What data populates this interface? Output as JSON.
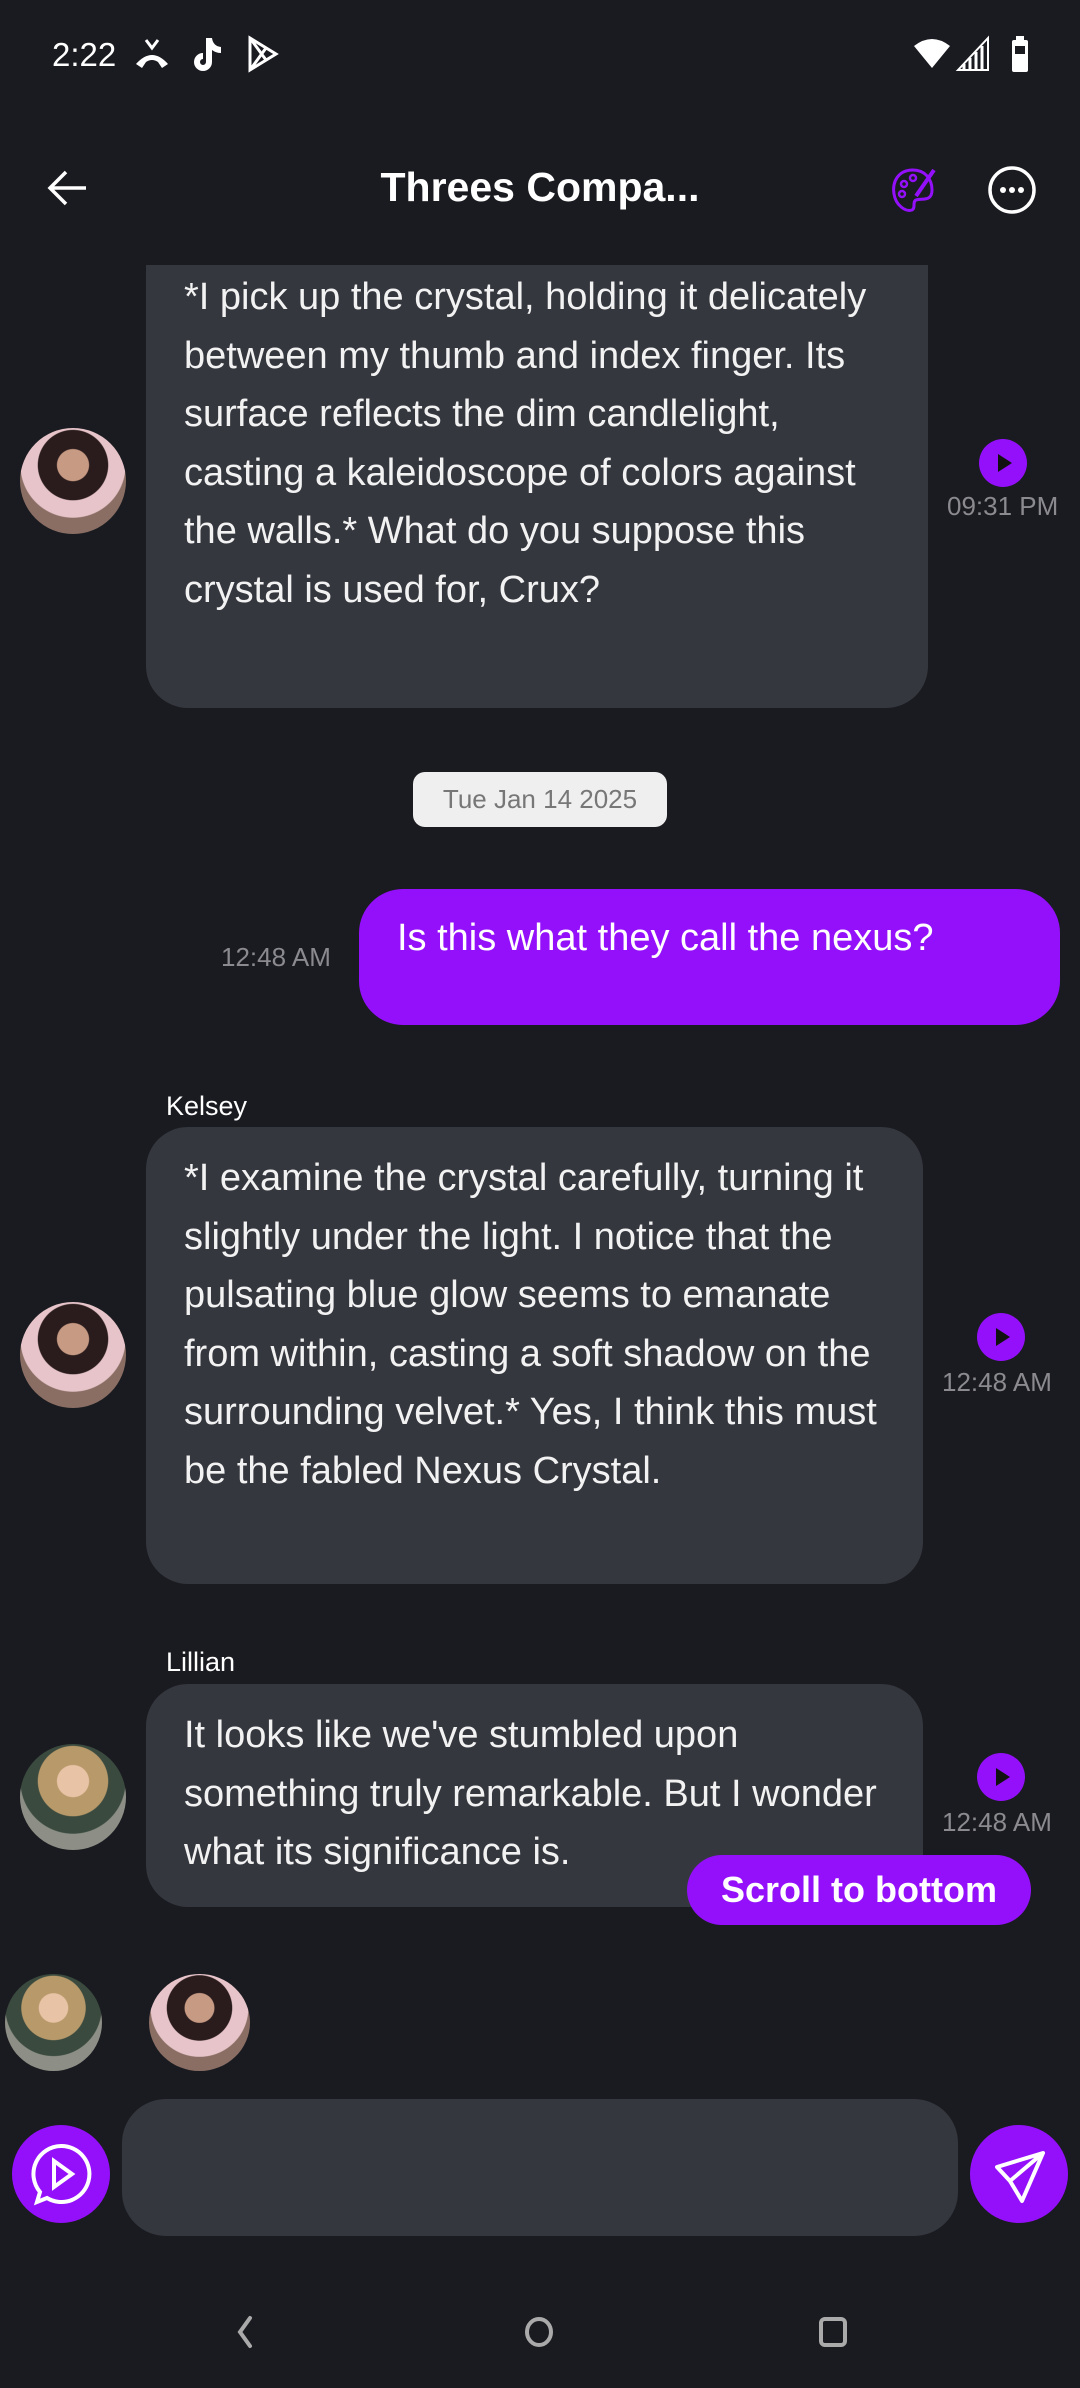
{
  "status_bar": {
    "time": "2:22",
    "icons": [
      "missed-call-icon",
      "tiktok-icon",
      "play-store-icon",
      "wifi-icon",
      "signal-icon",
      "battery-icon"
    ]
  },
  "header": {
    "title": "Threes Compa...",
    "icons": [
      "back-arrow-icon",
      "palette-icon",
      "more-options-icon"
    ]
  },
  "colors": {
    "accent": "#9410fb",
    "background": "#1a1b20",
    "bubble": "#35373f"
  },
  "messages": [
    {
      "sender": "",
      "text": "*I pick up the crystal, holding it delicately between my thumb and index finger. Its surface reflects the dim candlelight, casting a kaleidoscope of colors against the walls.* What do you suppose this crystal is used for, Crux?",
      "time": "09:31 PM"
    },
    {
      "date": "Tue Jan 14 2025"
    },
    {
      "sender": "me",
      "text": "Is this what they call the nexus?",
      "time": "12:48 AM"
    },
    {
      "sender": "Kelsey",
      "text": "*I examine the crystal carefully, turning it slightly under the light. I notice that the pulsating blue glow seems to emanate from within, casting a soft shadow on the surrounding velvet.* Yes, I think this must be the fabled Nexus Crystal.",
      "time": "12:48 AM"
    },
    {
      "sender": "Lillian",
      "text": "It looks like we've stumbled upon something truly remarkable. But I wonder what its significance is.",
      "time": "12:48 AM"
    }
  ],
  "scroll_to_bottom": "Scroll to bottom",
  "composer": {
    "value": "",
    "placeholder": ""
  }
}
